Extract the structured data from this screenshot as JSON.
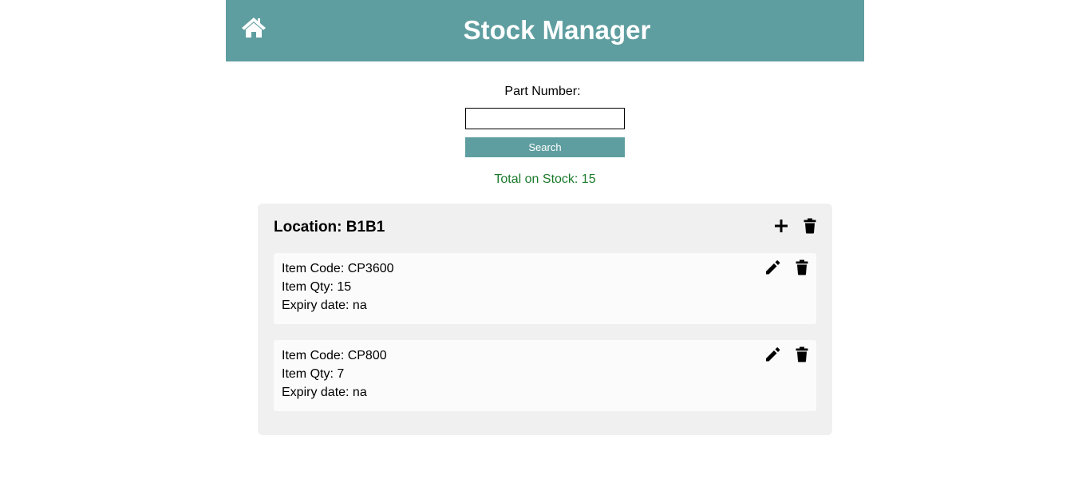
{
  "header": {
    "title": "Stock Manager",
    "home_icon": "home-icon",
    "background_color": "#5f9ea0"
  },
  "search": {
    "label": "Part Number:",
    "value": "",
    "placeholder": "",
    "button_label": "Search"
  },
  "total": {
    "text": "Total on Stock: 15",
    "color": "#1a7a2a"
  },
  "location": {
    "title": "Location: B1B1",
    "add_icon": "plus-icon",
    "delete_icon": "trash-icon",
    "items": [
      {
        "code": "Item Code: CP3600",
        "qty": "Item Qty: 15",
        "expiry": "Expiry date: na",
        "edit_icon": "pencil-icon",
        "delete_icon": "trash-icon"
      },
      {
        "code": "Item Code: CP800",
        "qty": "Item Qty: 7",
        "expiry": "Expiry date: na",
        "edit_icon": "pencil-icon",
        "delete_icon": "trash-icon"
      }
    ]
  }
}
